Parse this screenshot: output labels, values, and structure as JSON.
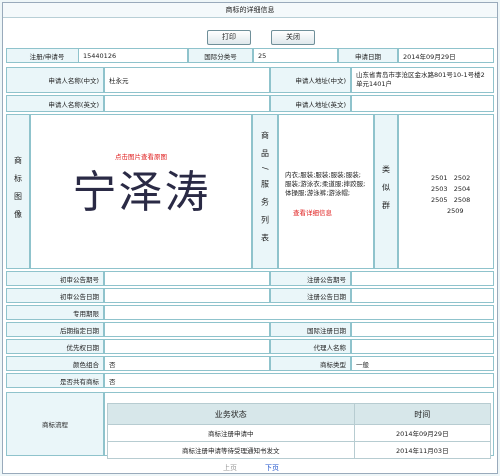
{
  "window": {
    "title": "商标的详细信息"
  },
  "toolbar": {
    "print_label": "打印",
    "close_label": "关闭"
  },
  "row1": {
    "reg_label": "注册/申请号",
    "reg_value": "15440126",
    "class_label": "国际分类号",
    "class_value": "25",
    "date_label": "申请日期",
    "date_value": "2014年09月29日"
  },
  "applicant": {
    "name_cn_label": "申请人名称(中文)",
    "name_cn_value": "杜永元",
    "addr_cn_label": "申请人地址(中文)",
    "addr_cn_value": "山东省青岛市李沧区金水路801号10-1号楼2单元1401户",
    "name_en_label": "申请人名称(英文)",
    "name_en_value": "",
    "addr_en_label": "申请人地址(英文)",
    "addr_en_value": ""
  },
  "image_section": {
    "label": "商标图像",
    "hint": "点击图片查看原图",
    "mark_text": "宁泽涛"
  },
  "goods_section": {
    "label": "商品/服务列表",
    "items": "内衣;服装;服装;服装;服装;服装;游泳衣;柔道服;摔跤服;体操服;游泳裤;游泳帽;",
    "detail_link": "查看详细信息"
  },
  "groups_section": {
    "label": "类似群",
    "codes": [
      [
        "2501",
        "2502"
      ],
      [
        "2503",
        "2504"
      ],
      [
        "2505",
        "2508"
      ],
      [
        "2509",
        ""
      ]
    ]
  },
  "details": {
    "prelim_no_label": "初审公告期号",
    "prelim_no_value": "",
    "reg_no_label": "注册公告期号",
    "reg_no_value": "",
    "prelim_date_label": "初审公告日期",
    "prelim_date_value": "",
    "reg_date_label": "注册公告日期",
    "reg_date_value": "",
    "exclusive_label": "专用期限",
    "exclusive_value": "",
    "later_label": "后期指定日期",
    "later_value": "",
    "intl_reg_label": "国际注册日期",
    "intl_reg_value": "",
    "priority_label": "优先权日期",
    "priority_value": "",
    "agent_label": "代理人名称",
    "agent_value": "",
    "color_label": "颜色组合",
    "color_value": "否",
    "type_label": "商标类型",
    "type_value": "一般",
    "shared_label": "是否共有商标",
    "shared_value": "否"
  },
  "flow": {
    "label": "商标流程",
    "headers": [
      "业务状态",
      "时间"
    ],
    "rows": [
      [
        "商标注册申请中",
        "2014年09月29日"
      ],
      [
        "商标注册申请等待受理通知书发文",
        "2014年11月03日"
      ]
    ]
  },
  "pager": {
    "prev_label": "上页",
    "next_label": "下页"
  }
}
